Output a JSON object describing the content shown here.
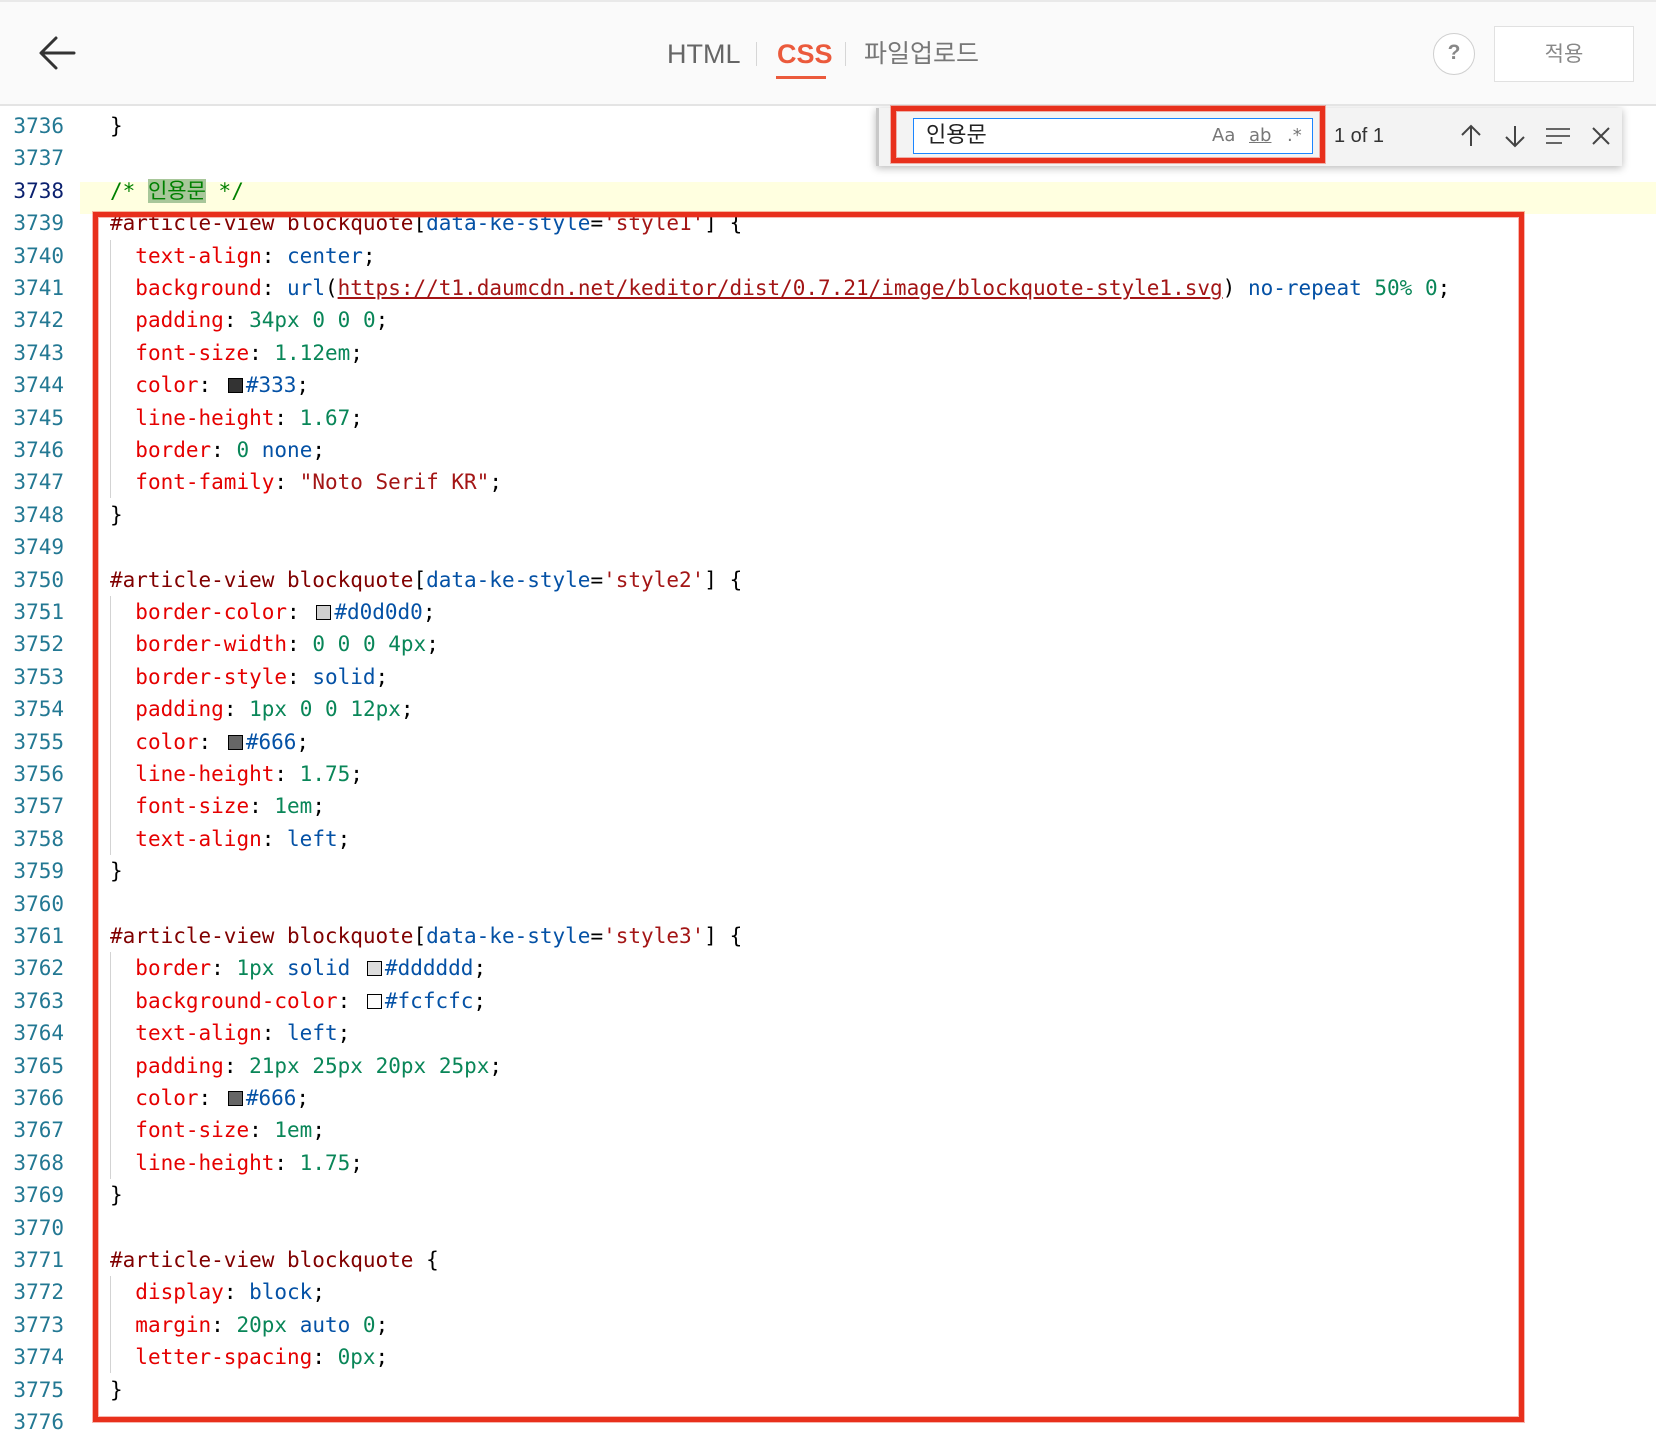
{
  "header": {
    "tabs": [
      {
        "label": "HTML"
      },
      {
        "label": "CSS"
      },
      {
        "label": "파일업로드"
      }
    ],
    "help_label": "?",
    "apply_label": "적용"
  },
  "find": {
    "query": "인용문",
    "match_case_label": "Aa",
    "whole_word_label": "ab",
    "regex_label": ".*",
    "count": "1 of 1"
  },
  "code": {
    "line_numbers": [
      "3736",
      "3737",
      "3738",
      "3739",
      "3740",
      "3741",
      "3742",
      "3743",
      "3744",
      "3745",
      "3746",
      "3747",
      "3748",
      "3749",
      "3750",
      "3751",
      "3752",
      "3753",
      "3754",
      "3755",
      "3756",
      "3757",
      "3758",
      "3759",
      "3760",
      "3761",
      "3762",
      "3763",
      "3764",
      "3765",
      "3766",
      "3767",
      "3768",
      "3769",
      "3770",
      "3771",
      "3772",
      "3773",
      "3774",
      "3775",
      "3776"
    ],
    "active_line": "3738",
    "lines": [
      "}",
      "",
      "/* 인용문 */",
      "#article-view blockquote[data-ke-style='style1'] {",
      "  text-align: center;",
      "  background: url(https://t1.daumcdn.net/keditor/dist/0.7.21/image/blockquote-style1.svg) no-repeat 50% 0;",
      "  padding: 34px 0 0 0;",
      "  font-size: 1.12em;",
      "  color: #333;",
      "  line-height: 1.67;",
      "  border: 0 none;",
      "  font-family: \"Noto Serif KR\";",
      "}",
      "",
      "#article-view blockquote[data-ke-style='style2'] {",
      "  border-color: #d0d0d0;",
      "  border-width: 0 0 0 4px;",
      "  border-style: solid;",
      "  padding: 1px 0 0 12px;",
      "  color: #666;",
      "  line-height: 1.75;",
      "  font-size: 1em;",
      "  text-align: left;",
      "}",
      "",
      "#article-view blockquote[data-ke-style='style3'] {",
      "  border: 1px solid #dddddd;",
      "  background-color: #fcfcfc;",
      "  text-align: left;",
      "  padding: 21px 25px 20px 25px;",
      "  color: #666;",
      "  font-size: 1em;",
      "  line-height: 1.75;",
      "}",
      "",
      "#article-view blockquote {",
      "  display: block;",
      "  margin: 20px auto 0;",
      "  letter-spacing: 0px;",
      "}",
      ""
    ],
    "swatch_colors": {
      "#333": "#333333",
      "#d0d0d0": "#d0d0d0",
      "#666": "#666666",
      "#dddddd": "#dddddd",
      "#fcfcfc": "#fcfcfc"
    }
  },
  "colors": {
    "accent": "#eb5a3c",
    "annotation_red": "#e8301c",
    "selector": "#800000",
    "property": "#e50000",
    "value_keyword": "#0451a5",
    "number": "#098658",
    "string": "#a31515",
    "comment": "#008000",
    "line_number": "#237893"
  },
  "icons": {
    "back": "arrow-left-icon",
    "help": "question-icon",
    "prev_match": "arrow-up-icon",
    "next_match": "arrow-down-icon",
    "find_in_selection": "lines-icon",
    "close": "close-icon"
  }
}
